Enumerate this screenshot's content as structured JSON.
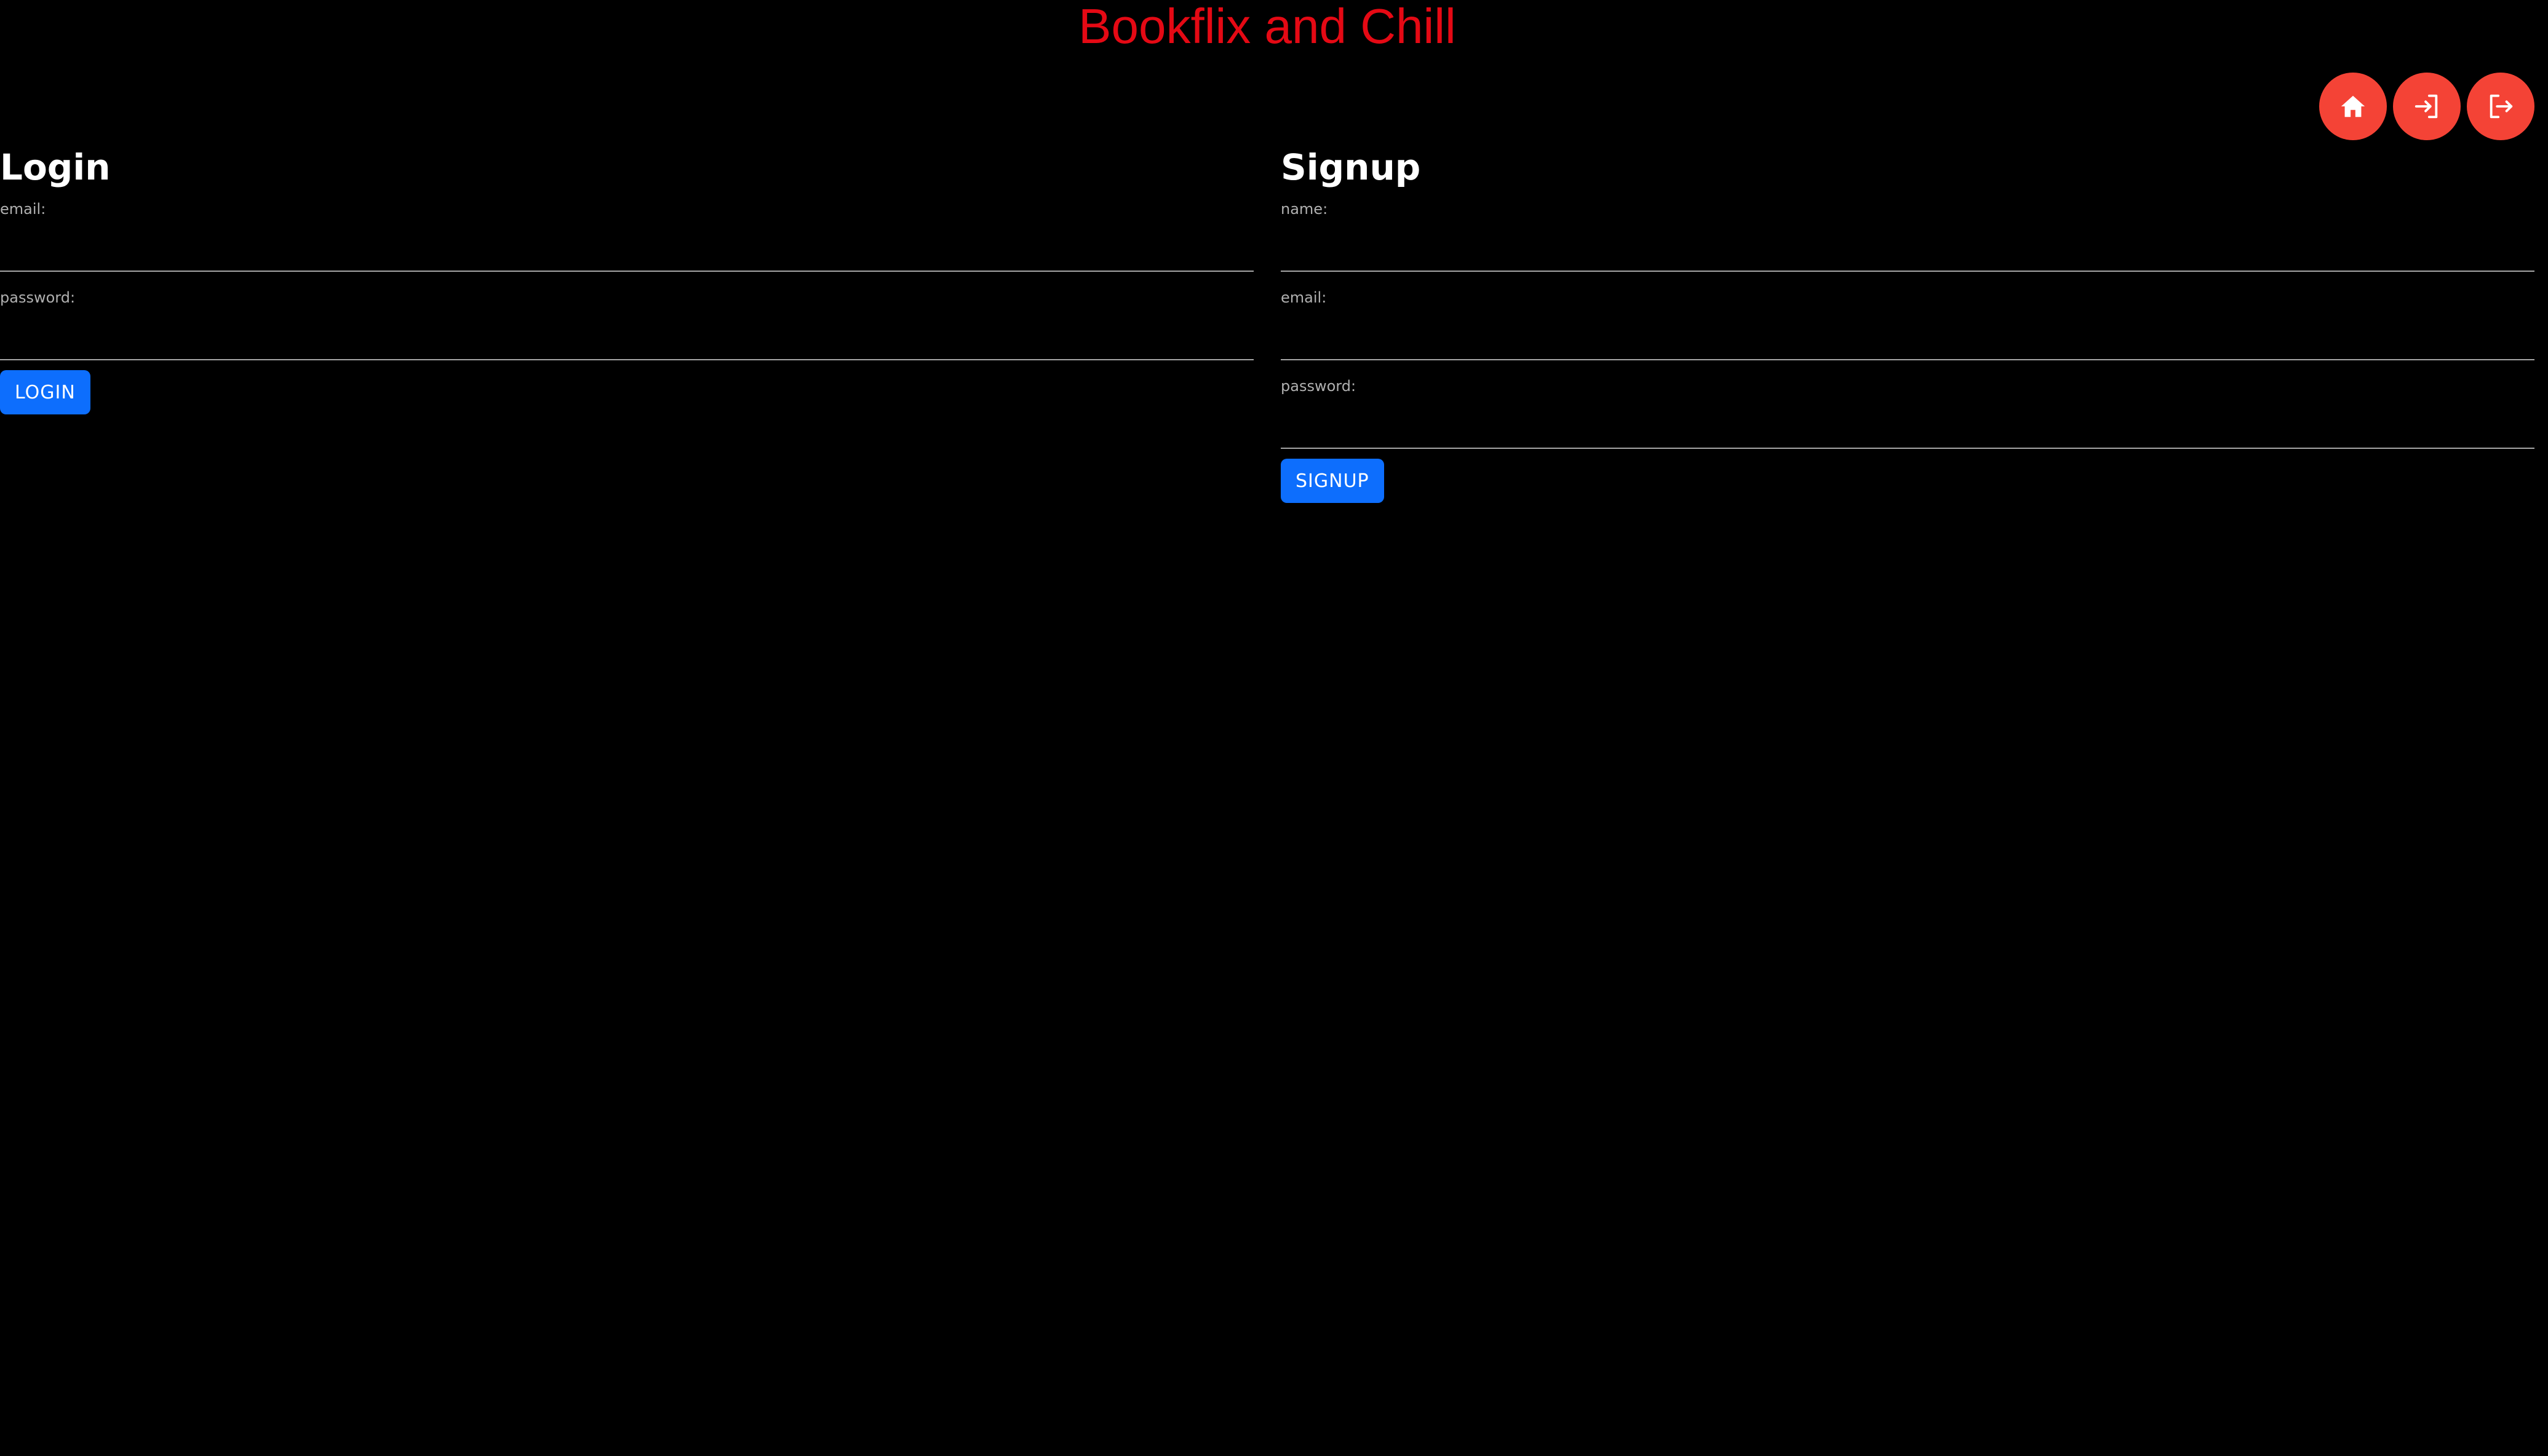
{
  "header": {
    "title": "Bookflix and Chill",
    "title_color": "#e50914"
  },
  "nav": {
    "buttons": [
      {
        "name": "home",
        "icon": "home-icon"
      },
      {
        "name": "login",
        "icon": "login-icon"
      },
      {
        "name": "logout",
        "icon": "logout-icon"
      }
    ],
    "button_color": "#f44336"
  },
  "login": {
    "heading": "Login",
    "fields": [
      {
        "label": "email:",
        "value": ""
      },
      {
        "label": "password:",
        "value": ""
      }
    ],
    "button_label": "LOGIN"
  },
  "signup": {
    "heading": "Signup",
    "fields": [
      {
        "label": "name:",
        "value": ""
      },
      {
        "label": "email:",
        "value": ""
      },
      {
        "label": "password:",
        "value": ""
      }
    ],
    "button_label": "SIGNUP"
  },
  "colors": {
    "background": "#000000",
    "primary_button": "#0d6efd"
  }
}
